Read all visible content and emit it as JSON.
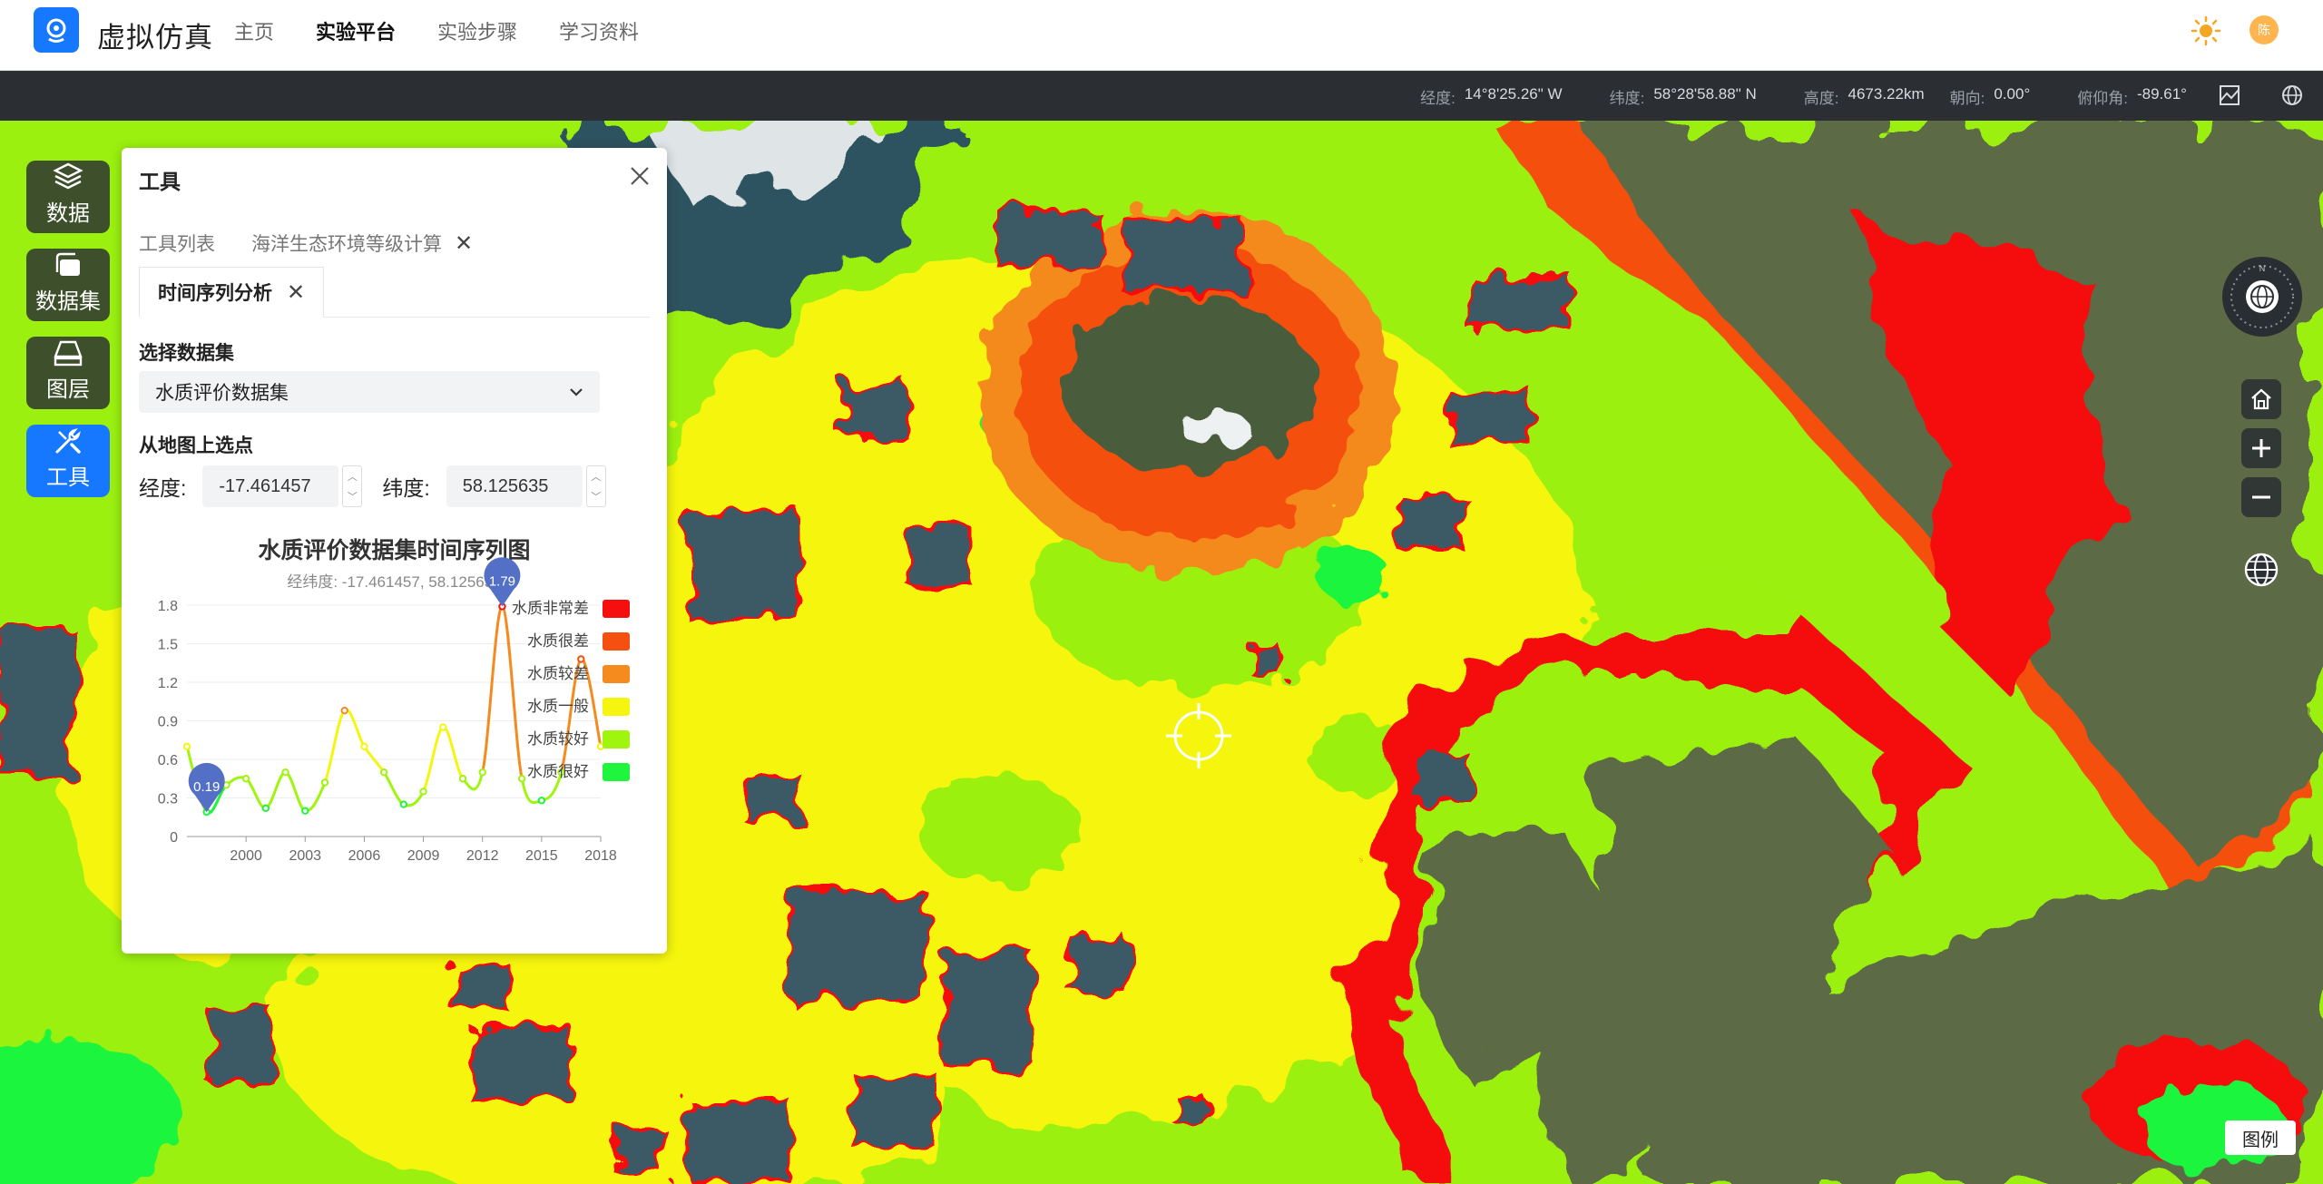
{
  "app": {
    "name": "虚拟仿真"
  },
  "nav": {
    "items": [
      "主页",
      "实验平台",
      "实验步骤",
      "学习资料"
    ],
    "active": "实验平台"
  },
  "user": {
    "avatar_text": "陈"
  },
  "status": {
    "lon_label": "经度:",
    "lon": "14°8'25.26\" W",
    "lat_label": "纬度:",
    "lat": "58°28'58.88\" N",
    "alt_label": "高度:",
    "alt": "4673.22km",
    "heading_label": "朝向:",
    "heading": "0.00°",
    "pitch_label": "俯仰角:",
    "pitch": "-89.61°"
  },
  "sidebar": {
    "items": [
      "数据",
      "数据集",
      "图层",
      "工具"
    ],
    "active": "工具"
  },
  "panel": {
    "title": "工具",
    "tabs": [
      "工具列表",
      "海洋生态环境等级计算"
    ],
    "active_tab": "时间序列分析",
    "dataset_label": "选择数据集",
    "dataset_value": "水质评价数据集",
    "pick_label": "从地图上选点",
    "lon_label": "经度:",
    "lon_value": "-17.461457",
    "lat_label": "纬度:",
    "lat_value": "58.125635"
  },
  "chart_data": {
    "type": "line",
    "title": "水质评价数据集时间序列图",
    "subtitle": "经纬度: -17.461457, 58.125635",
    "x": [
      1997,
      1998,
      1999,
      2000,
      2001,
      2002,
      2003,
      2004,
      2005,
      2006,
      2007,
      2008,
      2009,
      2010,
      2011,
      2012,
      2013,
      2014,
      2015,
      2016,
      2017,
      2018
    ],
    "values": [
      0.7,
      0.19,
      0.4,
      0.45,
      0.22,
      0.5,
      0.2,
      0.42,
      0.98,
      0.7,
      0.5,
      0.25,
      0.35,
      0.85,
      0.45,
      0.5,
      1.79,
      0.45,
      0.28,
      0.5,
      1.38,
      0.7
    ],
    "xticks": [
      "2000",
      "2003",
      "2006",
      "2009",
      "2012",
      "2015",
      "2018"
    ],
    "yticks": [
      "0",
      "0.3",
      "0.6",
      "0.9",
      "1.2",
      "1.5",
      "1.8"
    ],
    "ylim": [
      0,
      1.8
    ],
    "markers": [
      {
        "label": "0.19",
        "kind": "min"
      },
      {
        "label": "1.79",
        "kind": "max"
      }
    ],
    "legend": [
      {
        "name": "水质非常差",
        "color": "#f50f0f"
      },
      {
        "name": "水质很差",
        "color": "#f5500f"
      },
      {
        "name": "水质较差",
        "color": "#f58a1f"
      },
      {
        "name": "水质一般",
        "color": "#f5f50f"
      },
      {
        "name": "水质较好",
        "color": "#a0f50f"
      },
      {
        "name": "水质很好",
        "color": "#1ef53c"
      }
    ],
    "legend_position": "right"
  },
  "legend_button": "图例",
  "colors": {
    "accent": "#1677ff",
    "topbar": "#ffffff",
    "statusbar": "#2b2e33"
  }
}
